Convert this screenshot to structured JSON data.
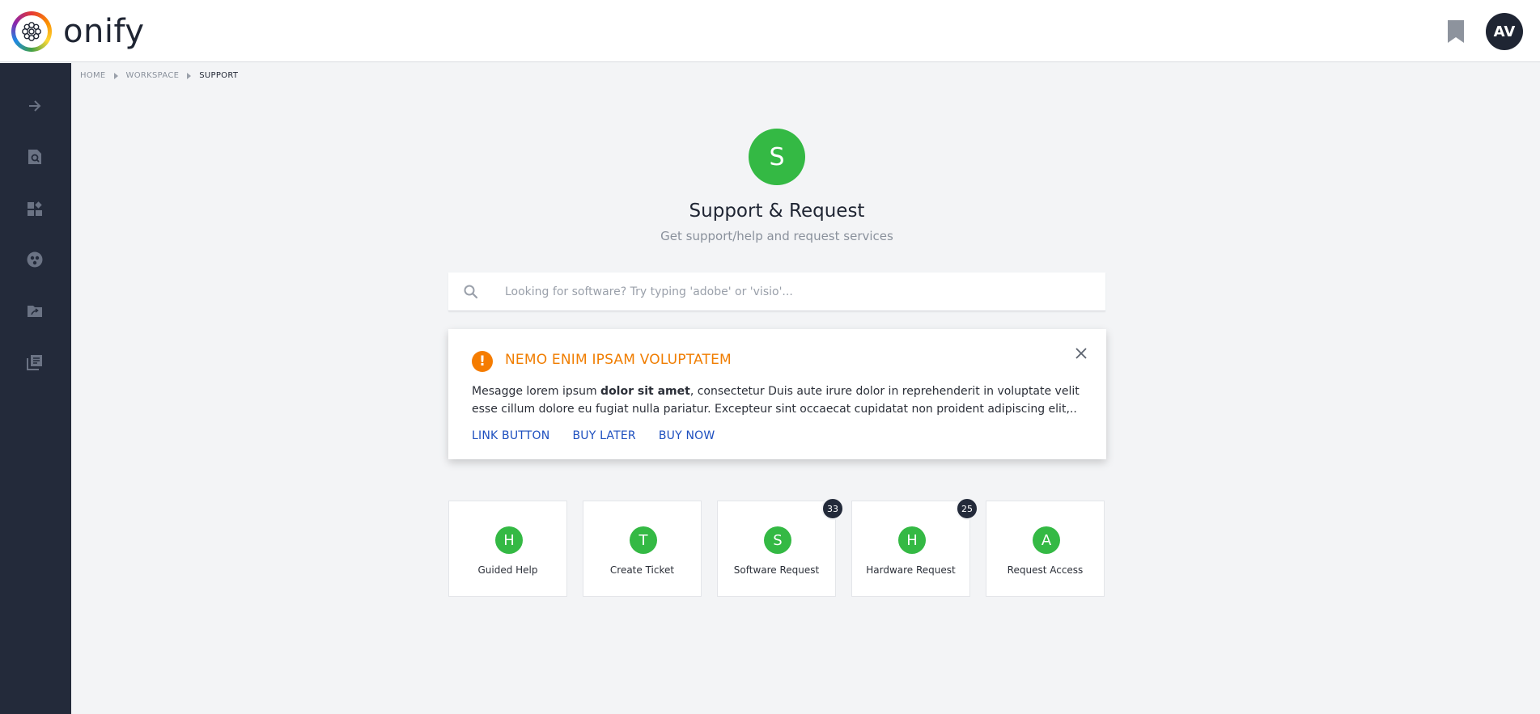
{
  "app": {
    "logo_text": "onify",
    "logo_icon": "flower-logo-icon",
    "user_initials": "AV",
    "bookmark_icon": "bookmark-icon"
  },
  "sidebar": {
    "items": [
      {
        "icon": "arrow-right-icon"
      },
      {
        "icon": "search-document-icon"
      },
      {
        "icon": "dashboard-widgets-icon"
      },
      {
        "icon": "group-circle-icon"
      },
      {
        "icon": "folder-shared-icon"
      },
      {
        "icon": "library-books-icon"
      }
    ]
  },
  "breadcrumb": {
    "items": [
      "HOME",
      "WORKSPACE",
      "SUPPORT"
    ]
  },
  "hero": {
    "initial": "S",
    "title": "Support & Request",
    "subtitle": "Get support/help and request services"
  },
  "search": {
    "placeholder": "Looking for software? Try typing 'adobe' or 'visio'...",
    "value": ""
  },
  "alert": {
    "icon_glyph": "!",
    "title": "NEMO ENIM IPSAM VOLUPTATEM",
    "body_prefix": "Mesagge lorem ipsum ",
    "body_bold": "dolor sit amet",
    "body_suffix": ", consectetur Duis aute irure dolor in reprehenderit in voluptate velit esse cillum dolore eu fugiat nulla pariatur. Excepteur sint occaecat cupidatat non proident adipiscing elit,..",
    "actions": [
      "LINK BUTTON",
      "BUY LATER",
      "BUY NOW"
    ]
  },
  "tiles": [
    {
      "initial": "H",
      "label": "Guided Help",
      "badge": ""
    },
    {
      "initial": "T",
      "label": "Create Ticket",
      "badge": ""
    },
    {
      "initial": "S",
      "label": "Software Request",
      "badge": "33"
    },
    {
      "initial": "H",
      "label": "Hardware Request",
      "badge": "25"
    },
    {
      "initial": "A",
      "label": "Request Access",
      "badge": ""
    }
  ],
  "colors": {
    "accent_green": "#34b944",
    "alert_orange": "#f07d00",
    "link_blue": "#1d4fbf",
    "sidebar_bg": "#232a3a"
  }
}
